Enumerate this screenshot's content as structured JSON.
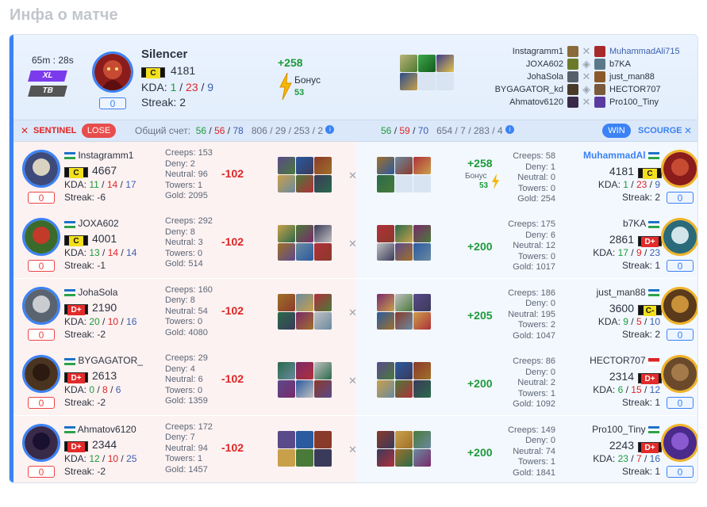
{
  "page_title": "Инфа о матче",
  "match": {
    "duration": "65m : 28s",
    "badge_xl": "XL",
    "badge_tb": "TB"
  },
  "mvp": {
    "name": "Silencer",
    "rank": "C",
    "rating": "4181",
    "kda_label": "KDA:",
    "k": "1",
    "d": "23",
    "a": "9",
    "sep": "/",
    "streak": "Streak: 2",
    "counter": "0",
    "gain": "+258",
    "bonus_label": "Бонус",
    "bonus_value": "53"
  },
  "matchup": [
    {
      "left": "Instagramm1",
      "right": "MuhammadAli715"
    },
    {
      "left": "JOXA602",
      "right": "b7KA"
    },
    {
      "left": "JohaSola",
      "right": "just_man88"
    },
    {
      "left": "BYGAGATOR_kd",
      "right": "HECTOR707"
    },
    {
      "left": "Ahmatov6120",
      "right": "Pro100_Tiny"
    }
  ],
  "bar": {
    "sentinel": "SENTINEL",
    "lose": "LOSE",
    "total_label": "Общий счет:",
    "s1": "56",
    "s2": "56",
    "s3": "78",
    "n1": "806",
    "n2": "29",
    "n3": "253",
    "n4": "2",
    "r1": "56",
    "r2": "59",
    "r3": "70",
    "m1": "654",
    "m2": "7",
    "m3": "283",
    "m4": "4",
    "win": "WIN",
    "scourge": "SCOURGE",
    "info": "i"
  },
  "players": [
    {
      "name": "Instagramm1",
      "rank": "C",
      "rating": "4667",
      "k": "11",
      "d": "14",
      "a": "17",
      "streak": "Streak: -6",
      "counter": "0",
      "creeps": "Creeps: 153",
      "deny": "Deny: 2",
      "neutral": "Neutral: 96",
      "towers": "Towers: 1",
      "gold": "Gold: 2095",
      "delta": "-102",
      "r_name": "MuhammadAl",
      "r_rank": "C",
      "r_rating": "4181",
      "r_k": "1",
      "r_d": "23",
      "r_a": "9",
      "r_streak": "Streak: 2",
      "r_counter": "0",
      "r_creeps": "Creeps: 58",
      "r_deny": "Deny: 1",
      "r_neutral": "Neutral: 0",
      "r_towers": "Towers: 0",
      "r_gold": "Gold: 254",
      "r_delta": "+258",
      "r_bonus_label": "Бонус",
      "r_bonus": "53"
    },
    {
      "name": "JOXA602",
      "rank": "C",
      "rating": "4001",
      "k": "13",
      "d": "14",
      "a": "14",
      "streak": "Streak: -1",
      "counter": "0",
      "creeps": "Creeps: 292",
      "deny": "Deny: 8",
      "neutral": "Neutral: 3",
      "towers": "Towers: 0",
      "gold": "Gold: 514",
      "delta": "-102",
      "r_name": "b7KA",
      "r_rank": "D+",
      "r_rating": "2861",
      "r_k": "17",
      "r_d": "9",
      "r_a": "23",
      "r_streak": "Streak: 1",
      "r_counter": "0",
      "r_creeps": "Creeps: 175",
      "r_deny": "Deny: 6",
      "r_neutral": "Neutral: 12",
      "r_towers": "Towers: 0",
      "r_gold": "Gold: 1017",
      "r_delta": "+200"
    },
    {
      "name": "JohaSola",
      "rank": "D+",
      "rating": "2190",
      "k": "20",
      "d": "10",
      "a": "16",
      "streak": "Streak: -2",
      "counter": "0",
      "creeps": "Creeps: 160",
      "deny": "Deny: 8",
      "neutral": "Neutral: 54",
      "towers": "Towers: 0",
      "gold": "Gold: 4080",
      "delta": "-102",
      "r_name": "just_man88",
      "r_rank": "C-",
      "r_rating": "3600",
      "r_k": "9",
      "r_d": "5",
      "r_a": "10",
      "r_streak": "Streak: 2",
      "r_counter": "0",
      "r_creeps": "Creeps: 186",
      "r_deny": "Deny: 0",
      "r_neutral": "Neutral: 195",
      "r_towers": "Towers: 2",
      "r_gold": "Gold: 1047",
      "r_delta": "+205"
    },
    {
      "name": "BYGAGATOR_",
      "rank": "D+",
      "rating": "2613",
      "k": "0",
      "d": "8",
      "a": "6",
      "streak": "Streak: -2",
      "counter": "0",
      "creeps": "Creeps: 29",
      "deny": "Deny: 4",
      "neutral": "Neutral: 6",
      "towers": "Towers: 0",
      "gold": "Gold: 1359",
      "delta": "-102",
      "r_name": "HECTOR707",
      "r_rank": "D+",
      "r_rating": "2314",
      "r_k": "6",
      "r_d": "15",
      "r_a": "12",
      "r_streak": "Streak: 1",
      "r_counter": "0",
      "r_creeps": "Creeps: 86",
      "r_deny": "Deny: 0",
      "r_neutral": "Neutral: 2",
      "r_towers": "Towers: 1",
      "r_gold": "Gold: 1092",
      "r_delta": "+200"
    },
    {
      "name": "Ahmatov6120",
      "rank": "D+",
      "rating": "2344",
      "k": "12",
      "d": "10",
      "a": "25",
      "streak": "Streak: -2",
      "counter": "0",
      "creeps": "Creeps: 172",
      "deny": "Deny: 7",
      "neutral": "Neutral: 94",
      "towers": "Towers: 1",
      "gold": "Gold: 1457",
      "delta": "-102",
      "r_name": "Pro100_Tiny",
      "r_rank": "D+",
      "r_rating": "2243",
      "r_k": "23",
      "r_d": "7",
      "r_a": "16",
      "r_streak": "Streak: 1",
      "r_counter": "0",
      "r_creeps": "Creeps: 149",
      "r_deny": "Deny: 0",
      "r_neutral": "Neutral: 74",
      "r_towers": "Towers: 1",
      "r_gold": "Gold: 1841",
      "r_delta": "+200"
    }
  ],
  "colors": {
    "accent": "#3b82f6",
    "win": "#1d9a3a",
    "lose": "#e02424"
  }
}
